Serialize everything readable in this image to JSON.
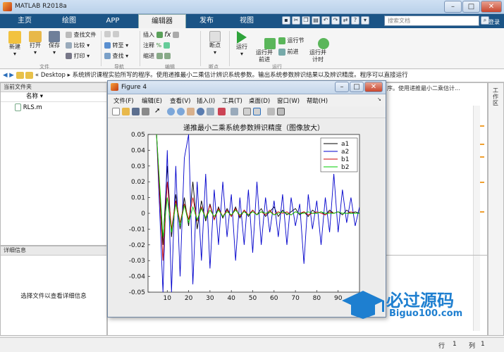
{
  "app_title": "MATLAB R2018a",
  "tabs": [
    "主页",
    "绘图",
    "APP",
    "编辑器",
    "发布",
    "视图"
  ],
  "search_placeholder": "搜索文档",
  "login": "登录",
  "ribbon": {
    "new": "新建",
    "open": "打开",
    "save": "保存",
    "find_files": "查找文件",
    "compare": "比较",
    "print": "打印",
    "goto": "转至",
    "find": "查找",
    "insert": "插入",
    "comment": "注释",
    "indent": "缩进",
    "breakpoint": "断点",
    "run": "运行",
    "run_advance": "运行并\n前进",
    "run_section": "运行节",
    "advance": "前进",
    "run_time": "运行并\n计时",
    "group_file": "文件",
    "group_nav": "导航",
    "group_edit": "编辑",
    "group_bp": "断点",
    "group_run": "运行"
  },
  "address": {
    "root": "Desktop",
    "path": "系统辨识课程实验所写的程序。使用递推最小二乘估计辨识系统参数。输出系统参数辨识结果以及辨识精度。程序可以直接运行"
  },
  "current_folder": {
    "title": "当前文件夹",
    "col_name": "名称",
    "files": [
      "RLS.m"
    ]
  },
  "details": {
    "title": "详细信息",
    "hint": "选择文件以查看详细信息"
  },
  "right_panel": {
    "title": "工作区",
    "text": "序。使用递推最小二乘估计..."
  },
  "figure": {
    "title": "Figure 4",
    "menu": [
      "文件(F)",
      "编辑(E)",
      "查看(V)",
      "插入(I)",
      "工具(T)",
      "桌面(D)",
      "窗口(W)",
      "帮助(H)"
    ]
  },
  "chart_data": {
    "type": "line",
    "title": "递推最小二乘系统参数辨识精度（图像放大）",
    "xlabel": "",
    "ylabel": "",
    "xlim": [
      1,
      100
    ],
    "ylim": [
      -0.05,
      0.05
    ],
    "xticks": [
      10,
      20,
      30,
      40,
      50,
      60,
      70,
      80,
      90
    ],
    "yticks": [
      -0.05,
      -0.04,
      -0.03,
      -0.02,
      -0.01,
      0,
      0.01,
      0.02,
      0.03,
      0.04,
      0.05
    ],
    "ytick_labels": [
      "-0.05",
      "-0.04",
      "-0.03",
      "-0.02",
      "-0.01",
      "0",
      "0.01",
      "0.02",
      "0.03",
      "0.04",
      "0.05"
    ],
    "legend_position": "top-right",
    "series": [
      {
        "name": "a1",
        "color": "#000000",
        "x": [
          5,
          8,
          10,
          12,
          14,
          16,
          18,
          20,
          22,
          24,
          26,
          28,
          30,
          32,
          34,
          36,
          38,
          40,
          42,
          44,
          46,
          48,
          50,
          52,
          54,
          56,
          58,
          60,
          62,
          64,
          66,
          68,
          70,
          72,
          74,
          76,
          78,
          80,
          82,
          84,
          86,
          88,
          90,
          92,
          94,
          96,
          98,
          100
        ],
        "y": [
          0.05,
          -0.02,
          0.03,
          -0.015,
          0.012,
          -0.01,
          0.01,
          -0.008,
          0.02,
          -0.01,
          0.008,
          -0.005,
          0.006,
          -0.004,
          0.004,
          -0.003,
          0.003,
          -0.002,
          0.004,
          -0.003,
          0.002,
          -0.002,
          0.002,
          -0.001,
          0.003,
          -0.002,
          0.001,
          0.004,
          -0.002,
          0.002,
          -0.001,
          0.001,
          0.003,
          -0.001,
          0.001,
          -0.002,
          0.002,
          0.0,
          0.001,
          -0.001,
          0.002,
          0.0,
          0.001,
          -0.001,
          0.002,
          0.0,
          0.001,
          0.0
        ]
      },
      {
        "name": "a2",
        "color": "#0000cc",
        "x": [
          5,
          8,
          10,
          12,
          14,
          16,
          18,
          20,
          22,
          24,
          26,
          28,
          30,
          32,
          34,
          36,
          38,
          40,
          42,
          44,
          46,
          48,
          50,
          52,
          54,
          56,
          58,
          60,
          62,
          64,
          66,
          68,
          70,
          72,
          74,
          76,
          78,
          80,
          82,
          84,
          86,
          88,
          90,
          92,
          94,
          96,
          98,
          100
        ],
        "y": [
          0.05,
          -0.05,
          0.04,
          -0.05,
          0.03,
          -0.04,
          0.035,
          0.05,
          -0.045,
          0.02,
          -0.03,
          0.025,
          -0.035,
          0.015,
          -0.02,
          0.02,
          -0.015,
          0.012,
          -0.03,
          0.01,
          -0.02,
          0.015,
          -0.025,
          0.02,
          -0.02,
          0.01,
          -0.012,
          0.008,
          -0.015,
          0.012,
          -0.02,
          0.01,
          -0.008,
          0.006,
          -0.032,
          0.012,
          -0.01,
          0.008,
          -0.02,
          0.01,
          -0.012,
          0.025,
          -0.012,
          0.015,
          -0.006,
          0.01,
          -0.008,
          0.004
        ]
      },
      {
        "name": "b1",
        "color": "#cc0000",
        "x": [
          5,
          8,
          10,
          12,
          14,
          16,
          18,
          20,
          22,
          24,
          26,
          28,
          30,
          32,
          34,
          36,
          38,
          40,
          42,
          44,
          46,
          48,
          50,
          52,
          54,
          56,
          58,
          60,
          62,
          64,
          66,
          68,
          70,
          72,
          74,
          76,
          78,
          80,
          82,
          84,
          86,
          88,
          90,
          92,
          94,
          96,
          98,
          100
        ],
        "y": [
          0.05,
          -0.03,
          0.02,
          -0.01,
          0.008,
          -0.006,
          0.006,
          -0.004,
          0.01,
          -0.005,
          0.004,
          -0.003,
          0.005,
          -0.004,
          0.003,
          -0.002,
          0.002,
          -0.002,
          0.003,
          -0.002,
          0.002,
          -0.001,
          0.002,
          -0.001,
          0.001,
          -0.001,
          0.002,
          -0.001,
          0.001,
          0.0,
          0.001,
          -0.001,
          0.001,
          0.0,
          0.001,
          -0.001,
          0.0,
          0.001,
          0.0,
          -0.001,
          0.001,
          0.0,
          0.001,
          0.0,
          0.0,
          0.001,
          0.0,
          0.0
        ]
      },
      {
        "name": "b2",
        "color": "#00cc00",
        "x": [
          5,
          8,
          10,
          12,
          14,
          16,
          18,
          20,
          22,
          24,
          26,
          28,
          30,
          32,
          34,
          36,
          38,
          40,
          42,
          44,
          46,
          48,
          50,
          52,
          54,
          56,
          58,
          60,
          62,
          64,
          66,
          68,
          70,
          72,
          74,
          76,
          78,
          80,
          82,
          84,
          86,
          88,
          90,
          92,
          94,
          96,
          98,
          100
        ],
        "y": [
          0.05,
          -0.015,
          0.01,
          -0.012,
          0.006,
          -0.008,
          0.005,
          -0.006,
          0.004,
          -0.004,
          0.003,
          -0.003,
          0.002,
          -0.002,
          0.002,
          -0.002,
          0.001,
          -0.001,
          0.002,
          -0.001,
          0.001,
          -0.001,
          0.001,
          -0.001,
          0.001,
          0.0,
          0.001,
          -0.001,
          0.0,
          0.001,
          0.0,
          -0.001,
          0.001,
          0.0,
          0.0,
          0.001,
          0.0,
          0.0,
          0.001,
          0.0,
          0.0,
          0.0,
          0.001,
          0.0,
          0.0,
          0.0,
          0.0,
          0.0
        ]
      }
    ]
  },
  "watermark": {
    "cn": "必过源码",
    "en": "Biguo100.com"
  },
  "status": {
    "row_label": "行",
    "row": "1",
    "col_label": "列",
    "col": "1"
  }
}
